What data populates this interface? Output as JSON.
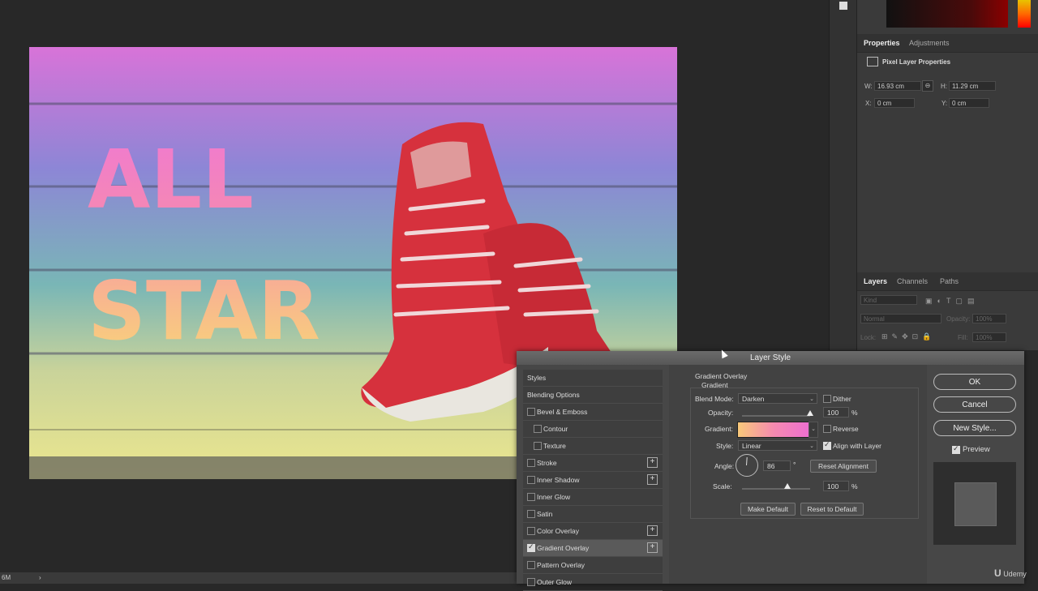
{
  "canvas": {
    "headline_line1": "ALL",
    "headline_line2": "STAR",
    "gradient_colors": [
      "#e76fd6",
      "#8a7cd9",
      "#7cc1b3",
      "#e6d58a"
    ]
  },
  "status": {
    "zoom": "6M",
    "arrow": "›"
  },
  "properties_panel": {
    "tabs": [
      "Properties",
      "Adjustments"
    ],
    "section_title": "Pixel Layer Properties",
    "w_label": "W:",
    "w_value": "16.93 cm",
    "h_label": "H:",
    "h_value": "11.29 cm",
    "x_label": "X:",
    "x_value": "0 cm",
    "y_label": "Y:",
    "y_value": "0 cm"
  },
  "layers_panel": {
    "tabs": [
      "Layers",
      "Channels",
      "Paths"
    ],
    "filter_placeholder": "Kind",
    "blend_mode": "Normal",
    "opacity_label": "Opacity:",
    "opacity_value": "100%",
    "lock_label": "Lock:",
    "fill_label": "Fill:",
    "fill_value": "100%"
  },
  "dialog": {
    "title": "Layer Style",
    "styles_header": "Styles",
    "items": [
      {
        "label": "Blending Options",
        "checkbox": false,
        "checked": false,
        "plus": false,
        "indent": 0
      },
      {
        "label": "Bevel & Emboss",
        "checkbox": true,
        "checked": false,
        "plus": false,
        "indent": 0
      },
      {
        "label": "Contour",
        "checkbox": true,
        "checked": false,
        "plus": false,
        "indent": 1
      },
      {
        "label": "Texture",
        "checkbox": true,
        "checked": false,
        "plus": false,
        "indent": 1
      },
      {
        "label": "Stroke",
        "checkbox": true,
        "checked": false,
        "plus": true,
        "indent": 0
      },
      {
        "label": "Inner Shadow",
        "checkbox": true,
        "checked": false,
        "plus": true,
        "indent": 0
      },
      {
        "label": "Inner Glow",
        "checkbox": true,
        "checked": false,
        "plus": false,
        "indent": 0
      },
      {
        "label": "Satin",
        "checkbox": true,
        "checked": false,
        "plus": false,
        "indent": 0
      },
      {
        "label": "Color Overlay",
        "checkbox": true,
        "checked": false,
        "plus": true,
        "indent": 0
      },
      {
        "label": "Gradient Overlay",
        "checkbox": true,
        "checked": true,
        "plus": true,
        "indent": 0,
        "selected": true
      },
      {
        "label": "Pattern Overlay",
        "checkbox": true,
        "checked": false,
        "plus": false,
        "indent": 0
      },
      {
        "label": "Outer Glow",
        "checkbox": true,
        "checked": false,
        "plus": false,
        "indent": 0
      }
    ],
    "settings": {
      "section_title": "Gradient Overlay",
      "section_subtitle": "Gradient",
      "blend_mode_label": "Blend Mode:",
      "blend_mode_value": "Darken",
      "dither_label": "Dither",
      "opacity_label": "Opacity:",
      "opacity_value": "100",
      "percent": "%",
      "gradient_label": "Gradient:",
      "gradient_colors": [
        "#f9c97a",
        "#f58ab0",
        "#ee6fd0"
      ],
      "reverse_label": "Reverse",
      "style_label": "Style:",
      "style_value": "Linear",
      "align_label": "Align with Layer",
      "angle_label": "Angle:",
      "angle_value": "86",
      "degree": "°",
      "reset_alignment": "Reset Alignment",
      "scale_label": "Scale:",
      "scale_value": "100",
      "make_default": "Make Default",
      "reset_default": "Reset to Default"
    },
    "buttons": {
      "ok": "OK",
      "cancel": "Cancel",
      "new_style": "New Style...",
      "preview": "Preview"
    }
  },
  "watermark": "Udemy"
}
